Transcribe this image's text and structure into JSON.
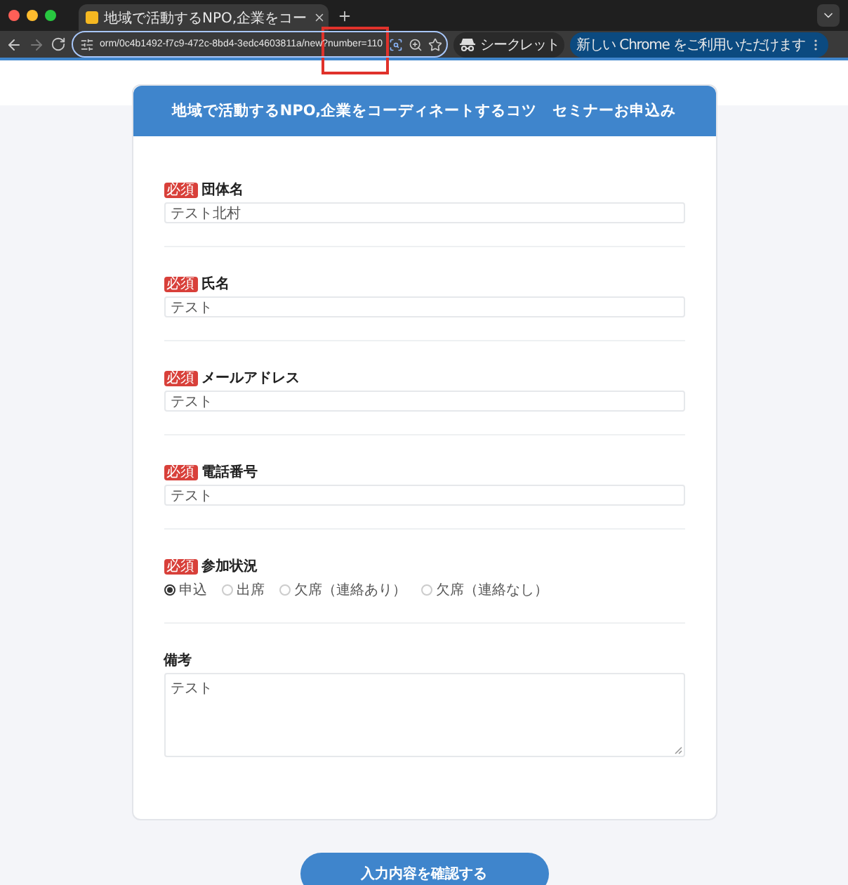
{
  "browser": {
    "tab_title": "地域で活動するNPO,企業をコー",
    "url": "orm/0c4b1492-f7c9-472c-8bd4-3edc4603811a/new?number=110",
    "incognito_label": "シークレット",
    "update_label": "新しい Chrome をご利用いただけます"
  },
  "form": {
    "title": "地域で活動するNPO,企業をコーディネートするコツ　セミナーお申込み",
    "fields": [
      {
        "kind": "text",
        "label": "団体名",
        "badge": "必須",
        "value": "テスト北村"
      },
      {
        "kind": "text",
        "label": "氏名",
        "badge": "必須",
        "value": "テスト"
      },
      {
        "kind": "text",
        "label": "メールアドレス",
        "badge": "必須",
        "value": "テスト"
      },
      {
        "kind": "text",
        "label": "電話番号",
        "badge": "必須",
        "value": "テスト"
      },
      {
        "kind": "radio",
        "label": "参加状況",
        "badge": "必須",
        "options": [
          {
            "label": "申込",
            "selected": true
          },
          {
            "label": "出席",
            "selected": false
          },
          {
            "label": "欠席（連絡あり）",
            "selected": false
          },
          {
            "label": "欠席（連絡なし）",
            "selected": false
          }
        ]
      },
      {
        "kind": "textarea",
        "label": "備考",
        "value": "テスト"
      }
    ],
    "submit_button": "入力内容を確認する"
  }
}
